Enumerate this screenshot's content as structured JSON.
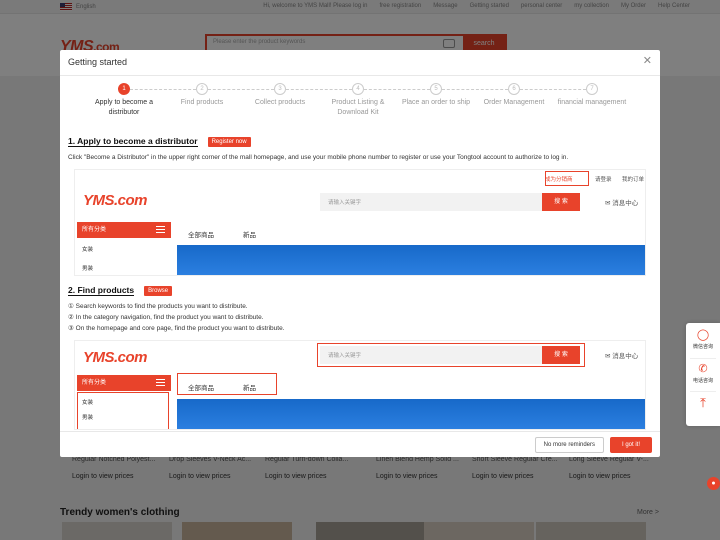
{
  "topbar": {
    "language": "English",
    "links": [
      "Hi, welcome to YMS Mall! Please log in",
      "free registration",
      "Message",
      "Getting started",
      "personal center",
      "my collection",
      "My Order",
      "Help Center"
    ]
  },
  "header": {
    "logo": "YMS",
    "logo_suffix": ".com",
    "search_placeholder": "Please enter the product keywords",
    "search_button": "search"
  },
  "products": [
    {
      "title": "Regular Notched Polyest...",
      "price": "Login to view prices"
    },
    {
      "title": "Drop Sleeves V-Neck Ac...",
      "price": "Login to view prices"
    },
    {
      "title": "Regular Turn-down Colla...",
      "price": "Login to view prices"
    },
    {
      "title": "Linen Blend Hemp Solid ...",
      "price": "Login to view prices"
    },
    {
      "title": "Short Sleeve Regular Cre...",
      "price": "Login to view prices"
    },
    {
      "title": "Long Sleeve Regular V-...",
      "price": "Login to view prices"
    }
  ],
  "section": {
    "title": "Trendy women's clothing",
    "more": "More >"
  },
  "sidebar": {
    "items": [
      {
        "label": "微信咨询",
        "icon": "wechat-icon"
      },
      {
        "label": "电话咨询",
        "icon": "phone-icon"
      },
      {
        "label": "",
        "icon": "back-to-top-icon"
      }
    ]
  },
  "modal": {
    "title": "Getting started",
    "steps": [
      {
        "num": "1",
        "label": "Apply to become a distributor",
        "active": true
      },
      {
        "num": "2",
        "label": "Find products",
        "active": false
      },
      {
        "num": "3",
        "label": "Collect products",
        "active": false
      },
      {
        "num": "4",
        "label": "Product Listing & Download Kit",
        "active": false
      },
      {
        "num": "5",
        "label": "Place an order to ship",
        "active": false
      },
      {
        "num": "6",
        "label": "Order Management",
        "active": false
      },
      {
        "num": "7",
        "label": "financial management",
        "active": false
      }
    ],
    "section1": {
      "heading": "1. Apply to become a distributor",
      "tag": "Register now",
      "text": "Click \"Become a Distributor\" in the upper right corner of the mall homepage, and use your mobile phone number to register or use your Tongtool account to authorize to log in."
    },
    "section2": {
      "heading": "2. Find products",
      "tag": "Browse",
      "lines": [
        "① Search keywords to find the products you want to distribute.",
        "② In the category navigation, find the product you want to distribute.",
        "③ On the homepage and core page, find the product you want to distribute."
      ]
    },
    "shot1": {
      "logo": "YMS.com",
      "top_links": [
        "成为分销商",
        "请登录",
        "我的订单"
      ],
      "search_placeholder": "请输入关键字",
      "search_button": "搜 索",
      "message": "消息中心",
      "category": "所有分类",
      "sub_items": [
        "女装",
        "男装"
      ],
      "nav": [
        "全部商品",
        "新品"
      ]
    },
    "shot2": {
      "logo": "YMS.com",
      "search_placeholder": "请输入关键字",
      "search_button": "搜 索",
      "message": "消息中心",
      "category": "所有分类",
      "sub_items": [
        "女装",
        "男装"
      ],
      "nav": [
        "全部商品",
        "新品"
      ]
    },
    "footer": {
      "no_more": "No more reminders",
      "ok": "I got it!"
    }
  },
  "colors": {
    "accent": "#e8432b",
    "banner": "#1e6fd0"
  }
}
